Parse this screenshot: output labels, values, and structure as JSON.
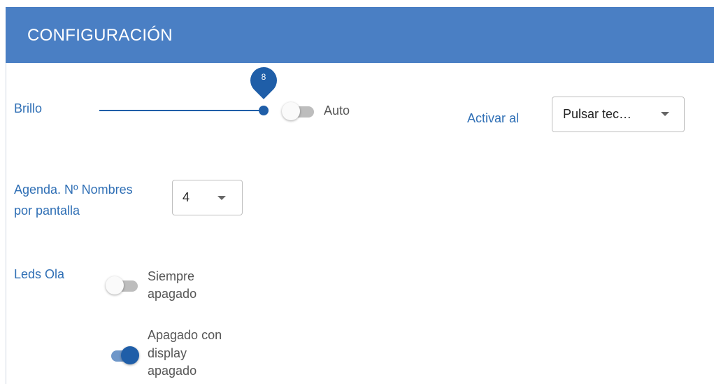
{
  "header": {
    "title": "CONFIGURACIÓN"
  },
  "brillo": {
    "label": "Brillo",
    "slider_value": "8",
    "auto_label": "Auto",
    "auto_enabled": false
  },
  "activar": {
    "label": "Activar al",
    "selected": "Pulsar tec…"
  },
  "agenda": {
    "label_line1": "Agenda. Nº Nombres",
    "label_line2": "por pantalla",
    "selected": "4"
  },
  "leds": {
    "label": "Leds Ola",
    "option1_line1": "Siempre",
    "option1_line2": "apagado",
    "option1_enabled": false,
    "option2_line1": "Apagado con",
    "option2_line2": "display",
    "option2_line3": "apagado",
    "option2_enabled": true
  },
  "colors": {
    "header": "#4a7fc4",
    "accent": "#1f5ea8",
    "label": "#2f6fb5"
  }
}
